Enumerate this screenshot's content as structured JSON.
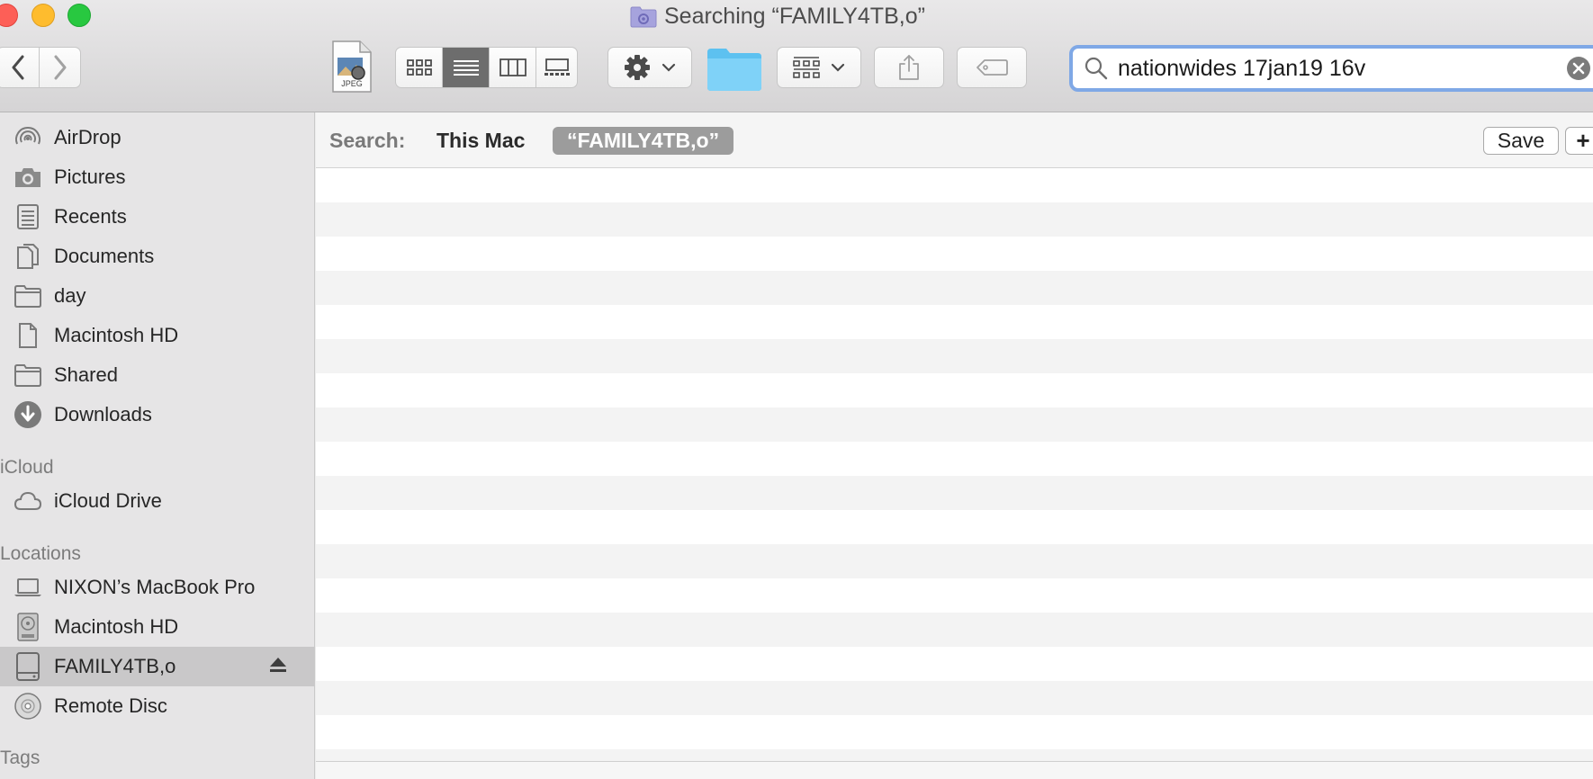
{
  "window": {
    "title": "Searching “FAMILY4TB,o”",
    "icon": "smart-folder-icon"
  },
  "toolbar": {
    "back_icon": "chevron-left-icon",
    "forward_icon": "chevron-right-icon",
    "preview_file_type": "JPEG",
    "view_modes": [
      "icon-view",
      "list-view",
      "column-view",
      "gallery-view"
    ],
    "active_view": "list-view",
    "action_icon": "gear-icon",
    "group_icon": "group-by-icon",
    "share_icon": "share-icon",
    "tag_icon": "tag-icon"
  },
  "search": {
    "query": "nationwides 17jan19 16v"
  },
  "scope": {
    "label": "Search:",
    "this_mac": "This Mac",
    "volume": "“FAMILY4TB,o”",
    "save_label": "Save",
    "add_label": "+"
  },
  "sidebar": {
    "favorites": [
      {
        "label": "AirDrop",
        "icon": "airdrop-icon"
      },
      {
        "label": "Pictures",
        "icon": "camera-icon"
      },
      {
        "label": "Recents",
        "icon": "recents-icon"
      },
      {
        "label": "Documents",
        "icon": "documents-icon"
      },
      {
        "label": "day",
        "icon": "folder-icon"
      },
      {
        "label": "Macintosh HD",
        "icon": "document-icon"
      },
      {
        "label": "Shared",
        "icon": "folder-icon"
      },
      {
        "label": "Downloads",
        "icon": "download-icon"
      }
    ],
    "icloud_header": "iCloud",
    "icloud": [
      {
        "label": "iCloud Drive",
        "icon": "cloud-icon"
      }
    ],
    "locations_header": "Locations",
    "locations": [
      {
        "label": "NIXON’s MacBook Pro",
        "icon": "laptop-icon"
      },
      {
        "label": "Macintosh HD",
        "icon": "internal-disk-icon"
      },
      {
        "label": "FAMILY4TB,o",
        "icon": "external-disk-icon",
        "selected": true,
        "eject": true
      },
      {
        "label": "Remote Disc",
        "icon": "disc-icon"
      }
    ],
    "tags_header": "Tags"
  },
  "colors": {
    "accent_focus": "#7fa8e6",
    "selection": "#c9c8c9",
    "scope_token": "#9c9c9c"
  }
}
